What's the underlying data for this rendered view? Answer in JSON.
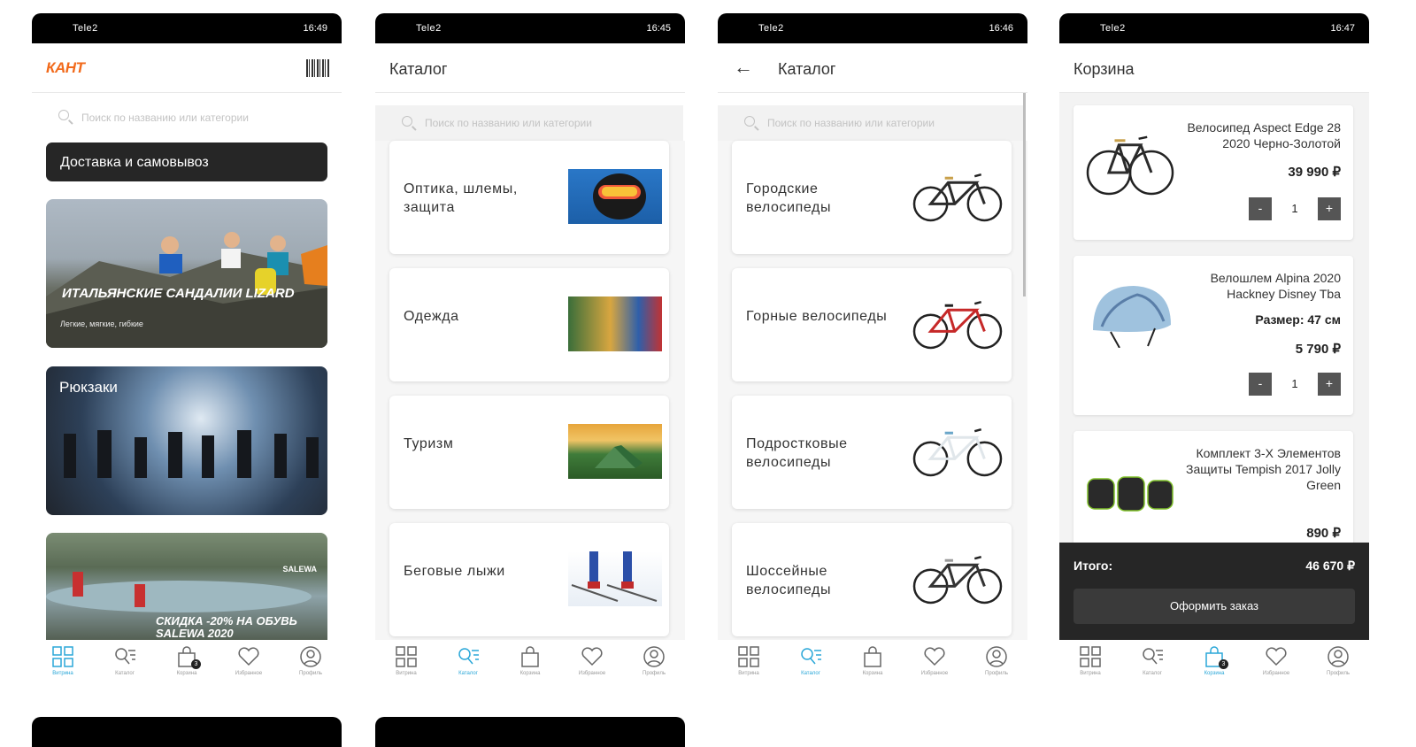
{
  "status": {
    "carrier": "Tele2",
    "time1": "16:49",
    "time2": "16:45",
    "time3": "16:46",
    "time4": "16:47"
  },
  "search_placeholder": "Поиск по названию или категории",
  "screen1": {
    "logo": "КАНТ",
    "delivery_label": "Доставка и самовывоз",
    "banner1_title": "ИТАЛЬЯНСКИЕ САНДАЛИИ LIZARD",
    "banner1_subtitle": "Легкие, мягкие, гибкие",
    "banner2_title": "Рюкзаки",
    "banner3_brand": "SALEWA",
    "banner3_title": "СКИДКА -20% НА ОБУВЬ SALEWA 2020"
  },
  "screen2": {
    "title": "Каталог",
    "items": [
      {
        "label": "Оптика, шлемы, защита",
        "icon": "goggles-image"
      },
      {
        "label": "Одежда",
        "icon": "clothes-image"
      },
      {
        "label": "Туризм",
        "icon": "tent-image"
      },
      {
        "label": "Беговые лыжи",
        "icon": "ski-image"
      }
    ]
  },
  "screen3": {
    "title": "Каталог",
    "items": [
      {
        "label": "Городские велосипеды",
        "frame_color": "#2b2b2b",
        "accent": "#c8a04a"
      },
      {
        "label": "Горные велосипеды",
        "frame_color": "#c62828",
        "accent": "#222222"
      },
      {
        "label": "Подростковые велосипеды",
        "frame_color": "#e0e6ea",
        "accent": "#6aa6c9"
      },
      {
        "label": "Шоссейные велосипеды",
        "frame_color": "#333333",
        "accent": "#9a9a9a"
      }
    ]
  },
  "screen4": {
    "title": "Корзина",
    "items": [
      {
        "name": "Велосипед Aspect Edge 28 2020 Черно-Золотой",
        "price": "39 990 ₽",
        "qty": "1"
      },
      {
        "name": "Велошлем Alpina 2020 Hackney Disney Tba",
        "size": "Размер: 47 см",
        "price": "5 790 ₽",
        "qty": "1"
      },
      {
        "name": "Комплект 3-Х Элементов Защиты Tempish 2017 Jolly Green",
        "price": "890 ₽"
      }
    ],
    "minus": "-",
    "plus": "+",
    "total_label": "Итого:",
    "total_value": "46 670 ₽",
    "order_button": "Оформить заказ"
  },
  "nav": {
    "labels": [
      "Витрина",
      "Каталог",
      "Корзина",
      "Избранное",
      "Профиль"
    ],
    "cart_badge": "3",
    "active_color": "#2aa7d8",
    "inactive_color": "#9a9a9a"
  }
}
